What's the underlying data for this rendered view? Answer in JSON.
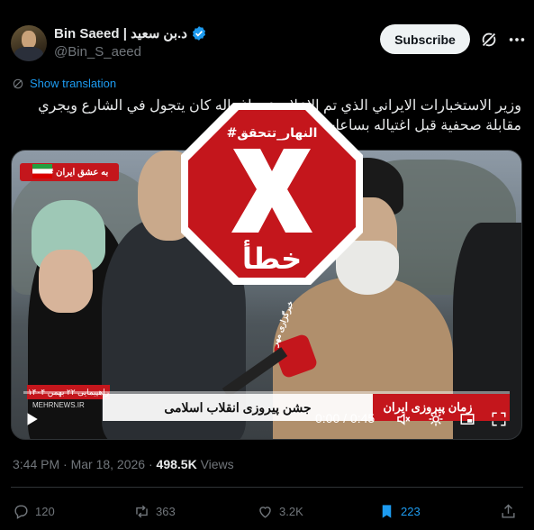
{
  "author": {
    "display_name": "د.بن سعيد | Bin Saeed",
    "handle": "@Bin_S_aeed"
  },
  "header": {
    "subscribe_label": "Subscribe"
  },
  "translation_label": "Show translation",
  "tweet_text": "وزير الاستخبارات الايراني الذي تم الاعلان عن اغتياله كان يتجول في الشارع ويجري مقابلة صحفية قبل اغتياله بساعات",
  "video": {
    "channel_tag": "# به عشق ایران",
    "date_tag": "راهپیمایی ۲۲ بهمن ۱۴۰۴",
    "source_watermark": "MEHRNEWS.IR",
    "caption": "جشن پیروزی انقلاب اسلامی",
    "channel_logo": "زمان پیروزی ایران",
    "mic_label": "خبرگزاری مهر",
    "time_display": "0:00 / 0:45",
    "progress": 0
  },
  "stamp": {
    "hashtag": "#النهار_تتحقق",
    "verdict": "خطأ",
    "color": "#c4161c"
  },
  "meta": {
    "time": "3:44 PM · Mar 18, 2026 · ",
    "views_count": "498.5K",
    "views_label": " Views"
  },
  "actions": {
    "replies": "120",
    "reposts": "363",
    "likes": "3.2K",
    "bookmarks": "223"
  },
  "colors": {
    "accent": "#1d9bf0",
    "muted": "#71767b",
    "background": "#000000"
  }
}
